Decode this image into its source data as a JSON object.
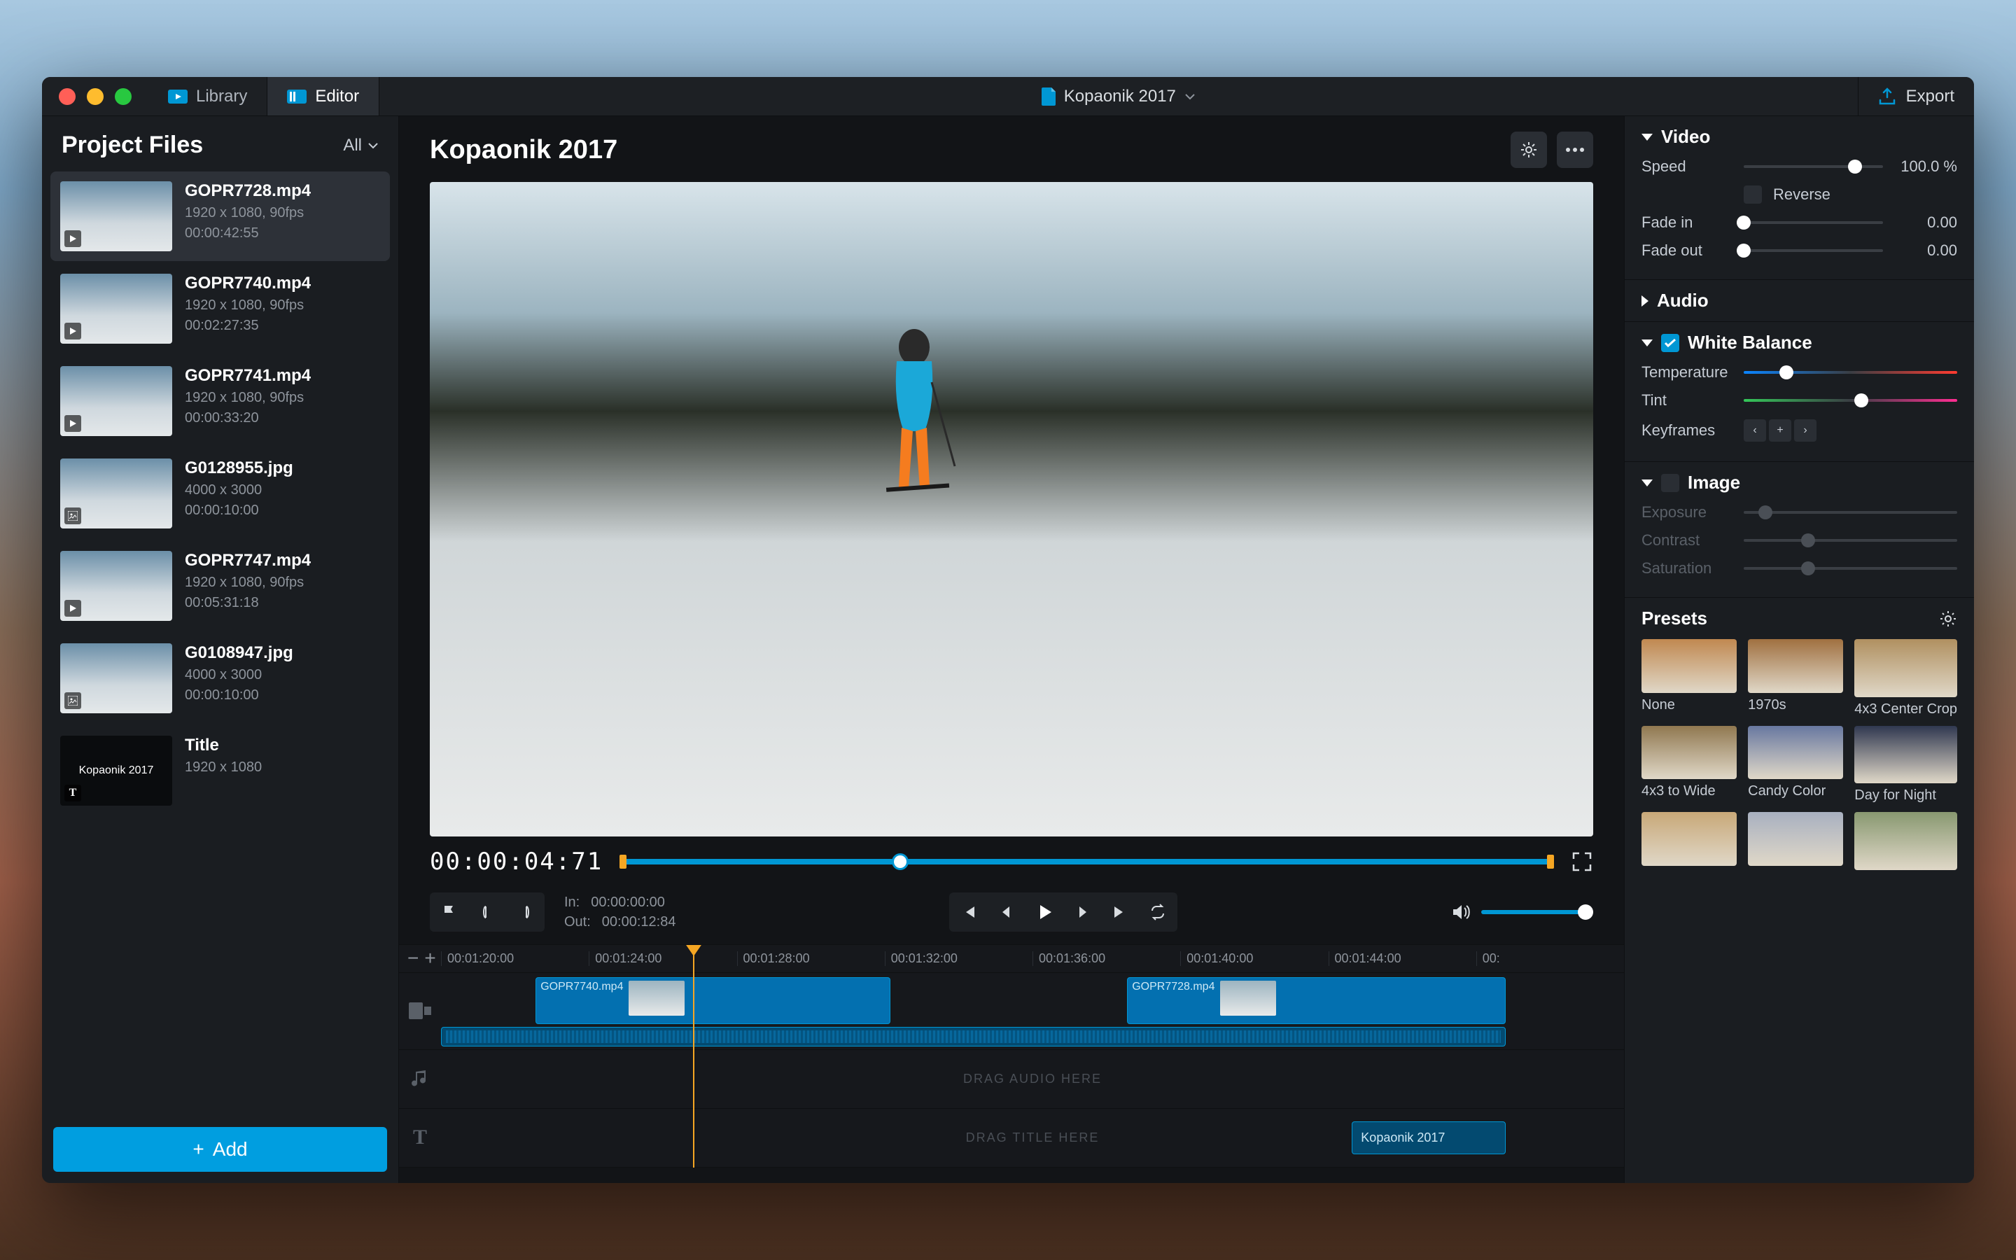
{
  "titlebar": {
    "tabs": [
      {
        "label": "Library",
        "active": false
      },
      {
        "label": "Editor",
        "active": true
      }
    ],
    "document_name": "Kopaonik 2017",
    "export_label": "Export"
  },
  "sidebar": {
    "title": "Project Files",
    "filter_label": "All",
    "add_label": "Add",
    "files": [
      {
        "name": "GOPR7728.mp4",
        "resolution": "1920 x 1080, 90fps",
        "duration": "00:00:42:55",
        "type": "video",
        "selected": true
      },
      {
        "name": "GOPR7740.mp4",
        "resolution": "1920 x 1080, 90fps",
        "duration": "00:02:27:35",
        "type": "video",
        "selected": false
      },
      {
        "name": "GOPR7741.mp4",
        "resolution": "1920 x 1080, 90fps",
        "duration": "00:00:33:20",
        "type": "video",
        "selected": false
      },
      {
        "name": "G0128955.jpg",
        "resolution": "4000 x 3000",
        "duration": "00:00:10:00",
        "type": "image",
        "selected": false
      },
      {
        "name": "GOPR7747.mp4",
        "resolution": "1920 x 1080, 90fps",
        "duration": "00:05:31:18",
        "type": "video",
        "selected": false
      },
      {
        "name": "G0108947.jpg",
        "resolution": "4000 x 3000",
        "duration": "00:00:10:00",
        "type": "image",
        "selected": false
      },
      {
        "name": "Title",
        "resolution": "1920 x 1080",
        "duration": "",
        "type": "title",
        "title_text": "Kopaonik 2017",
        "selected": false
      }
    ]
  },
  "preview": {
    "title": "Kopaonik 2017",
    "timecode": "00:00:04:71",
    "in_label": "In:",
    "out_label": "Out:",
    "in_time": "00:00:00:00",
    "out_time": "00:00:12:84",
    "scrub_position_pct": 30,
    "volume_pct": 100
  },
  "timeline": {
    "ticks": [
      "00:01:20:00",
      "00:01:24:00",
      "00:01:28:00",
      "00:01:32:00",
      "00:01:36:00",
      "00:01:40:00",
      "00:01:44:00",
      "00:"
    ],
    "playhead_pct": 30,
    "video_clips": [
      {
        "label": "GOPR7740.mp4",
        "left_pct": 8,
        "width_pct": 30
      },
      {
        "label": "GOPR7728.mp4",
        "left_pct": 58,
        "width_pct": 32
      }
    ],
    "audio_clip": {
      "left_pct": 0,
      "width_pct": 90
    },
    "audio_hint": "DRAG AUDIO HERE",
    "title_hint": "DRAG TITLE HERE",
    "title_clip": {
      "label": "Kopaonik 2017",
      "left_pct": 77,
      "width_pct": 13
    }
  },
  "inspector": {
    "video": {
      "title": "Video",
      "speed_label": "Speed",
      "speed_value": "100.0 %",
      "speed_pct": 80,
      "reverse_label": "Reverse",
      "fadein_label": "Fade in",
      "fadein_value": "0.00",
      "fadeout_label": "Fade out",
      "fadeout_value": "0.00"
    },
    "audio": {
      "title": "Audio"
    },
    "white_balance": {
      "title": "White Balance",
      "enabled": true,
      "temperature_label": "Temperature",
      "temperature_pct": 20,
      "tint_label": "Tint",
      "tint_pct": 55,
      "keyframes_label": "Keyframes"
    },
    "image": {
      "title": "Image",
      "enabled": false,
      "exposure_label": "Exposure",
      "contrast_label": "Contrast",
      "saturation_label": "Saturation"
    }
  },
  "presets": {
    "title": "Presets",
    "items": [
      "None",
      "1970s",
      "4x3 Center Crop",
      "4x3 to Wide",
      "Candy Color",
      "Day for Night",
      "",
      "",
      ""
    ]
  }
}
